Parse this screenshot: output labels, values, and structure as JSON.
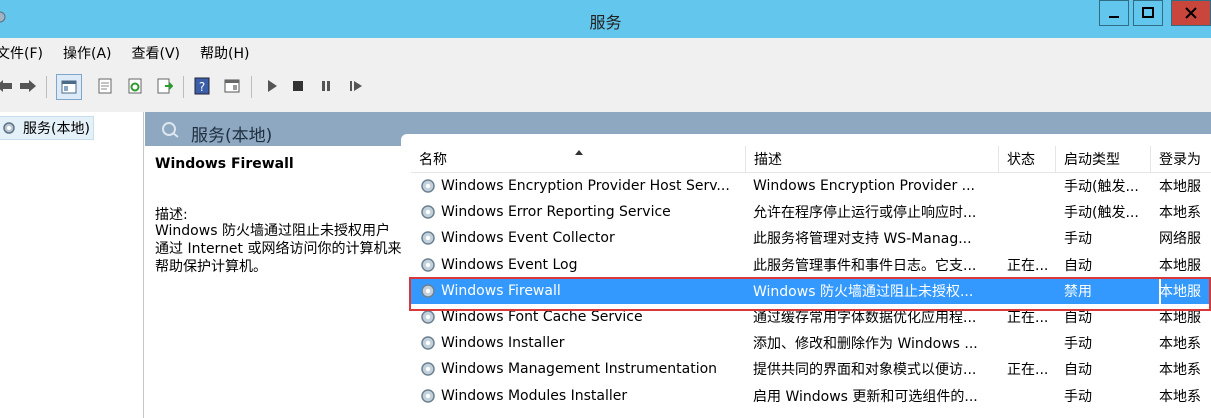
{
  "window": {
    "title": "服务",
    "minimize_glyph": "–",
    "maximize_glyph": "□",
    "close_glyph": "✕"
  },
  "menu": [
    "文件(F)",
    "操作(A)",
    "查看(V)",
    "帮助(H)"
  ],
  "toolbar": {
    "icons": [
      "back-icon",
      "forward-icon",
      "show-console-tree-icon",
      "properties-icon",
      "refresh-icon",
      "export-list-icon",
      "help-icon",
      "show-action-pane-icon",
      "start-service-icon",
      "stop-service-icon",
      "pause-service-icon",
      "resume-service-icon"
    ]
  },
  "tree": {
    "node_label": "服务(本地)"
  },
  "pane": {
    "header_label": "服务(本地)",
    "selected_name": "Windows Firewall",
    "description_label": "描述:",
    "description_text": "Windows 防火墙通过阻止未授权用户通过 Internet 或网络访问你的计算机来帮助保护计算机。"
  },
  "columns": {
    "name": "名称",
    "description": "描述",
    "status": "状态",
    "startup": "启动类型",
    "logon": "登录为"
  },
  "rows": [
    {
      "name": "Windows Encryption Provider Host Serv...",
      "description": "Windows Encryption Provider ...",
      "status": "",
      "startup": "手动(触发...",
      "logon": "本地服"
    },
    {
      "name": "Windows Error Reporting Service",
      "description": "允许在程序停止运行或停止响应时...",
      "status": "",
      "startup": "手动(触发...",
      "logon": "本地系"
    },
    {
      "name": "Windows Event Collector",
      "description": "此服务将管理对支持 WS-Manag...",
      "status": "",
      "startup": "手动",
      "logon": "网络服"
    },
    {
      "name": "Windows Event Log",
      "description": "此服务管理事件和事件日志。它支...",
      "status": "正在...",
      "startup": "自动",
      "logon": "本地服"
    },
    {
      "name": "Windows Firewall",
      "description": "Windows 防火墙通过阻止未授权...",
      "status": "",
      "startup": "禁用",
      "logon": "本地服",
      "selected": true
    },
    {
      "name": "Windows Font Cache Service",
      "description": "通过缓存常用字体数据优化应用程...",
      "status": "正在...",
      "startup": "自动",
      "logon": "本地服"
    },
    {
      "name": "Windows Installer",
      "description": "添加、修改和删除作为 Windows ...",
      "status": "",
      "startup": "手动",
      "logon": "本地系"
    },
    {
      "name": "Windows Management Instrumentation",
      "description": "提供共同的界面和对象模式以便访...",
      "status": "正在...",
      "startup": "自动",
      "logon": "本地系"
    },
    {
      "name": "Windows Modules Installer",
      "description": "启用 Windows 更新和可选组件的...",
      "status": "",
      "startup": "手动",
      "logon": "本地系"
    }
  ],
  "colors": {
    "titlebar": "#63c6ec",
    "selection": "#3399ff",
    "highlight_box": "#d9373a",
    "pane_header": "#8da8c0"
  }
}
